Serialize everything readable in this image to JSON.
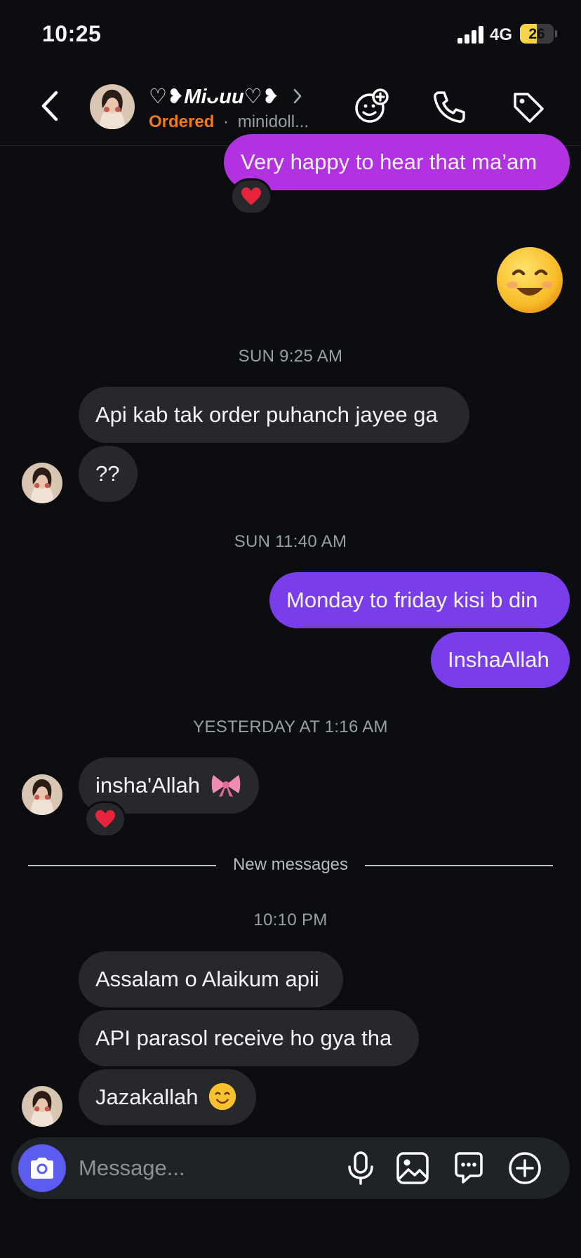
{
  "status": {
    "time": "10:25",
    "network": "4G",
    "battery": "26"
  },
  "header": {
    "name": "♡❥Miᴗuu♡❥",
    "status": "Ordered",
    "separator": "·",
    "username": "minidoll..."
  },
  "messages": [
    {
      "side": "out",
      "text": "Very happy to hear that ma’am",
      "reaction": "heart"
    },
    {
      "side": "out",
      "emoji": "smiling-face"
    },
    {
      "type": "timestamp",
      "text": "SUN 9:25 AM"
    },
    {
      "side": "in",
      "text": "Api kab tak order puhanch jayee ga"
    },
    {
      "side": "in",
      "text": "??"
    },
    {
      "type": "timestamp",
      "text": "SUN 11:40 AM"
    },
    {
      "side": "out",
      "text": "Monday to friday kisi b din"
    },
    {
      "side": "out",
      "text": "InshaAllah"
    },
    {
      "type": "timestamp",
      "text": "YESTERDAY AT 1:16 AM"
    },
    {
      "side": "in",
      "text": "insha'Allah",
      "reaction": "heart"
    },
    {
      "type": "divider",
      "text": "New messages"
    },
    {
      "type": "timestamp",
      "text": "10:10 PM"
    },
    {
      "side": "in",
      "text": "Assalam o Alaikum apii"
    },
    {
      "side": "in",
      "text": "API parasol receive ho gya tha"
    },
    {
      "side": "in",
      "text": "Jazakallah"
    }
  ],
  "composer": {
    "placeholder": "Message..."
  },
  "colors": {
    "background": "#0b0d10",
    "incoming_bubble": "#26282c",
    "outgoing_bubble": "#7a3dea",
    "outgoing_bubble_top": "#b231e0",
    "ordered_status": "#f0781d",
    "camera_button": "#5b5cf0"
  },
  "icons": [
    "back-chevron-icon",
    "add-person-icon",
    "phone-icon",
    "tag-icon",
    "camera-icon",
    "microphone-icon",
    "gallery-icon",
    "chat-bubble-icon",
    "plus-circle-icon",
    "heart-icon",
    "bow-icon",
    "smiling-face-icon"
  ]
}
